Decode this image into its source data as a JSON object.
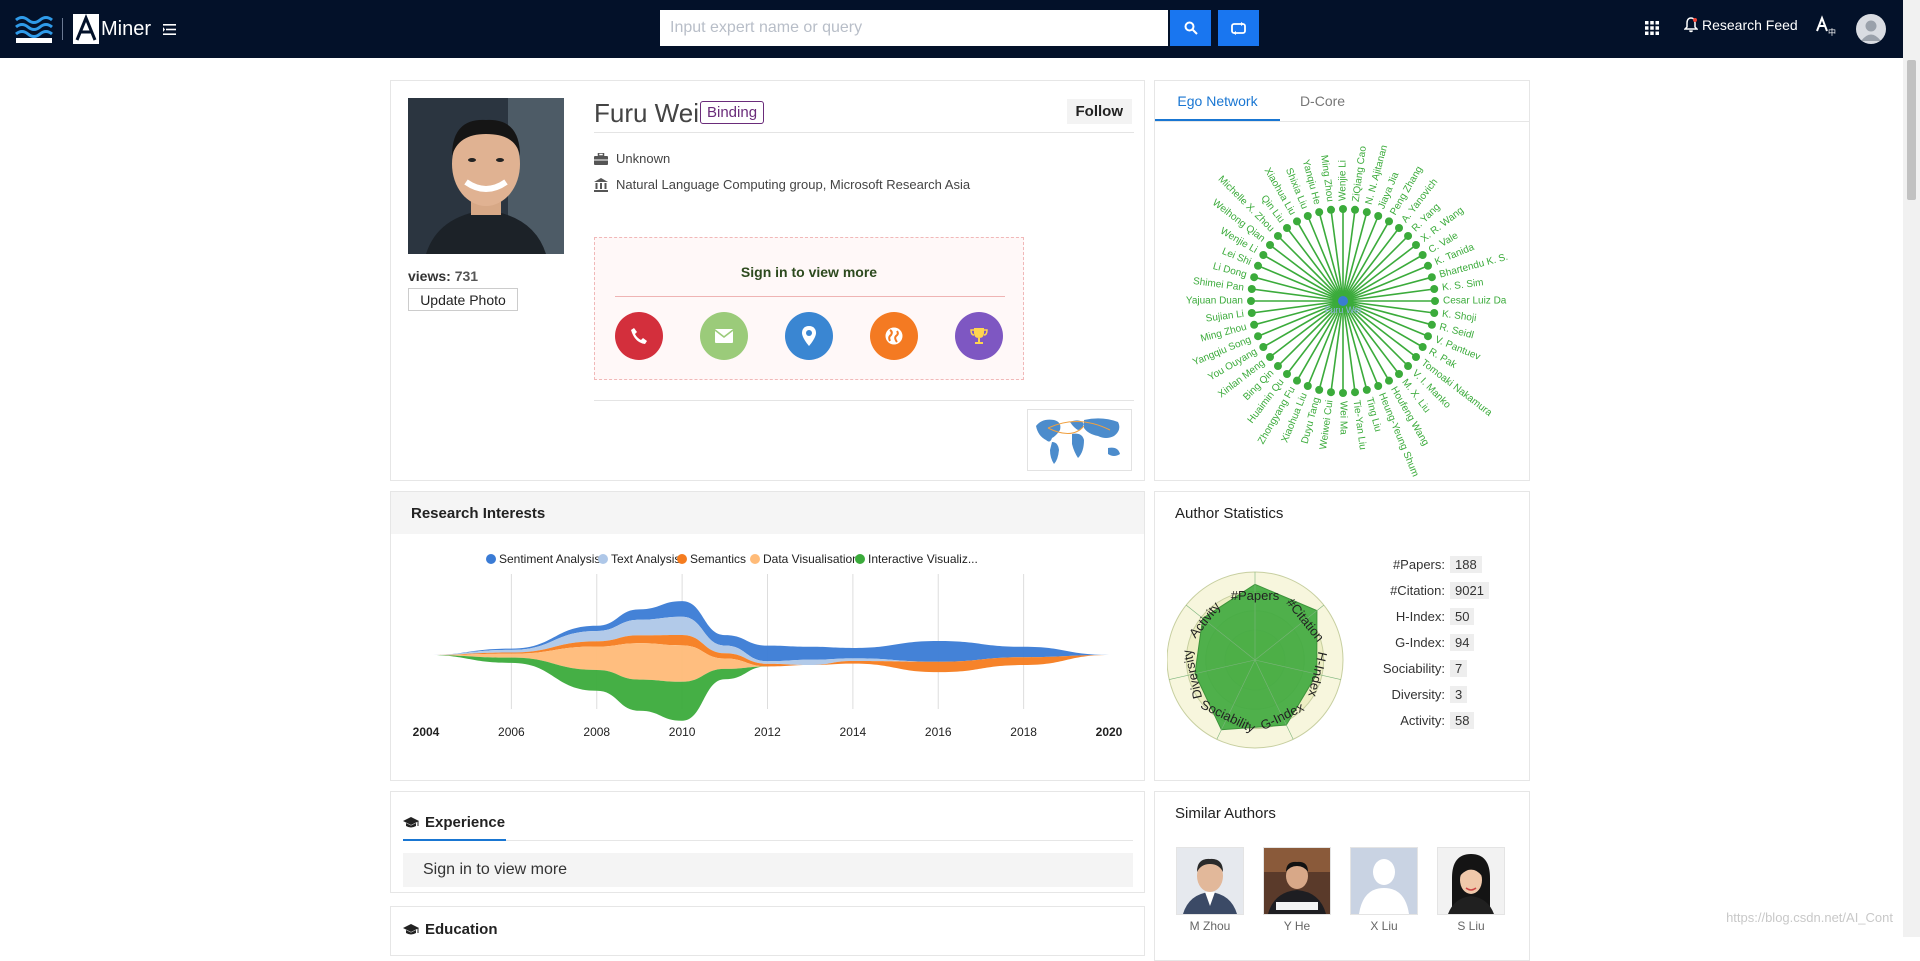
{
  "header": {
    "logo_text": "Miner",
    "search_placeholder": "Input expert name or query",
    "research_feed_label": "Research Feed"
  },
  "profile": {
    "name": "Furu Wei",
    "binding_label": "Binding",
    "follow_label": "Follow",
    "views_label": "views:",
    "views_count": "731",
    "update_photo_label": "Update Photo",
    "position": "Unknown",
    "affiliation": "Natural Language Computing group, Microsoft Research Asia",
    "signin_text": "Sign in to view more"
  },
  "ego_network": {
    "tabs": [
      "Ego Network",
      "D-Core"
    ],
    "center_name": "Furu Wei",
    "node_color": "#3bab3b",
    "center_color": "#3a7dd1",
    "nodes": [
      "Wenjie Li",
      "ZiQiang Cao",
      "N. N. Ajitanan",
      "Jiaya Jia",
      "Peng Zhang",
      "A. Yanovich",
      "R. Yang",
      "X. R. Wang",
      "C. Vale",
      "K. Tanida",
      "Bhartendu K. S.",
      "K. S. Sim",
      "Cesar Luiz Da",
      "K. Shoji",
      "R. Seidl",
      "V. Pantuev",
      "R. Pak",
      "Tomoaki Nakamura",
      "V. I. Manko",
      "M. X. Liu",
      "Houfeng Wang",
      "Heung-Yeung Shum",
      "Ting Liu",
      "Tie-Yan Liu",
      "Wei Ma",
      "Weiwei Cui",
      "Duyu Tang",
      "Xiaohua Liu",
      "Zhongyang Fu",
      "Huaimin Qu",
      "Bing Qin",
      "Xinlan Meng",
      "You Ouyang",
      "Yangqiu Song",
      "Ming Zhou",
      "Sujian Li",
      "Yajuan Duan",
      "Shimei Pan",
      "Li Dong",
      "Lei Shi",
      "Wenjie Li",
      "Weihong Qian",
      "Michelle X. Zhou",
      "Qin Liu",
      "Xiaohua Liu",
      "Shixia Liu",
      "Yanqiu He",
      "Ming Zhou"
    ]
  },
  "research_interests": {
    "title": "Research Interests",
    "chart_data": {
      "type": "area",
      "title": "",
      "x_ticks": [
        "2004",
        "2006",
        "2008",
        "2010",
        "2012",
        "2014",
        "2016",
        "2018",
        "2020"
      ],
      "x": [
        2004,
        2006,
        2008,
        2009,
        2010,
        2011,
        2012,
        2013,
        2014,
        2016,
        2018,
        2020
      ],
      "series": [
        {
          "name": "Sentiment Analysis",
          "color": "#3a7bd5",
          "values": [
            0,
            0.5,
            2,
            4,
            6,
            4,
            6,
            5,
            4,
            8,
            4,
            0
          ]
        },
        {
          "name": "Text Analysis",
          "color": "#aec7e8",
          "values": [
            0,
            1,
            4,
            6,
            7,
            3,
            1,
            2,
            1,
            0,
            0,
            0
          ]
        },
        {
          "name": "Semantics",
          "color": "#f57c1f",
          "values": [
            0,
            0.5,
            2,
            3,
            4,
            2,
            1,
            0,
            1,
            4,
            3,
            0
          ]
        },
        {
          "name": "Data Visualisation",
          "color": "#ffbb78",
          "values": [
            0,
            1.5,
            9,
            14,
            14,
            4,
            0,
            0,
            0,
            0,
            0,
            0
          ]
        },
        {
          "name": "Interactive Visualiz...",
          "color": "#3bab3b",
          "values": [
            0,
            2,
            8,
            12,
            15,
            4,
            0,
            0,
            0,
            0,
            0,
            0
          ]
        }
      ]
    }
  },
  "author_stats": {
    "title": "Author Statistics",
    "stats": [
      {
        "label": "#Papers:",
        "value": "188"
      },
      {
        "label": "#Citation:",
        "value": "9021"
      },
      {
        "label": "H-Index:",
        "value": "50"
      },
      {
        "label": "G-Index:",
        "value": "94"
      },
      {
        "label": "Sociability:",
        "value": "7"
      },
      {
        "label": "Diversity:",
        "value": "3"
      },
      {
        "label": "Activity:",
        "value": "58"
      }
    ],
    "radar": {
      "axes": [
        "#Papers",
        "#Citation",
        "H-Index",
        "G-Index",
        "Sociability",
        "Diversity",
        "Activity"
      ],
      "values": [
        0.86,
        0.9,
        0.72,
        0.82,
        0.88,
        0.7,
        0.76
      ]
    }
  },
  "experience": {
    "title": "Experience",
    "signin_text": "Sign in to view more"
  },
  "education": {
    "title": "Education"
  },
  "similar_authors": {
    "title": "Similar Authors",
    "authors": [
      {
        "name": "M Zhou"
      },
      {
        "name": "Y He"
      },
      {
        "name": "X Liu"
      },
      {
        "name": "S Liu"
      }
    ]
  },
  "watermark": "https://blog.csdn.net/AI_Cont"
}
